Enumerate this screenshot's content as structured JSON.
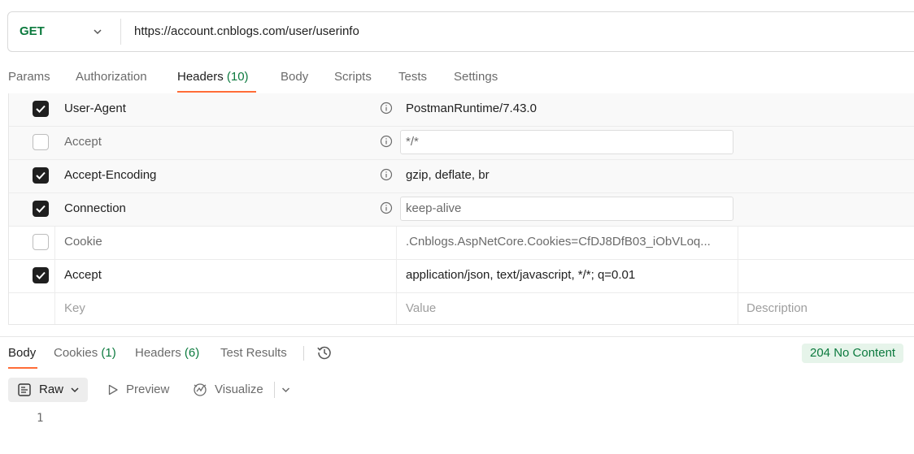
{
  "request": {
    "method": "GET",
    "url": "https://account.cnblogs.com/user/userinfo"
  },
  "request_tabs": [
    {
      "label": "Params"
    },
    {
      "label": "Authorization"
    },
    {
      "label": "Headers",
      "count": "(10)"
    },
    {
      "label": "Body"
    },
    {
      "label": "Scripts"
    },
    {
      "label": "Tests"
    },
    {
      "label": "Settings"
    }
  ],
  "headers": [
    {
      "key": "User-Agent",
      "value": "PostmanRuntime/7.43.0",
      "checked": true
    },
    {
      "key": "Accept",
      "value": "*/*",
      "checked": false
    },
    {
      "key": "Accept-Encoding",
      "value": "gzip, deflate, br",
      "checked": true
    },
    {
      "key": "Connection",
      "value": "keep-alive",
      "checked": true
    },
    {
      "key": "Cookie",
      "value": ".Cnblogs.AspNetCore.Cookies=CfDJ8DfB03_iObVLoq...",
      "checked": false
    },
    {
      "key": "Accept",
      "value": "application/json, text/javascript, */*; q=0.01",
      "checked": true
    }
  ],
  "new_row": {
    "key_placeholder": "Key",
    "value_placeholder": "Value",
    "description_placeholder": "Description"
  },
  "response_tabs": [
    {
      "label": "Body"
    },
    {
      "label": "Cookies",
      "count": "(1)"
    },
    {
      "label": "Headers",
      "count": "(6)"
    },
    {
      "label": "Test Results"
    }
  ],
  "status": "204 No Content",
  "response_toolbar": {
    "raw": "Raw",
    "preview": "Preview",
    "visualize": "Visualize"
  },
  "editor": {
    "line_numbers": [
      "1"
    ]
  }
}
